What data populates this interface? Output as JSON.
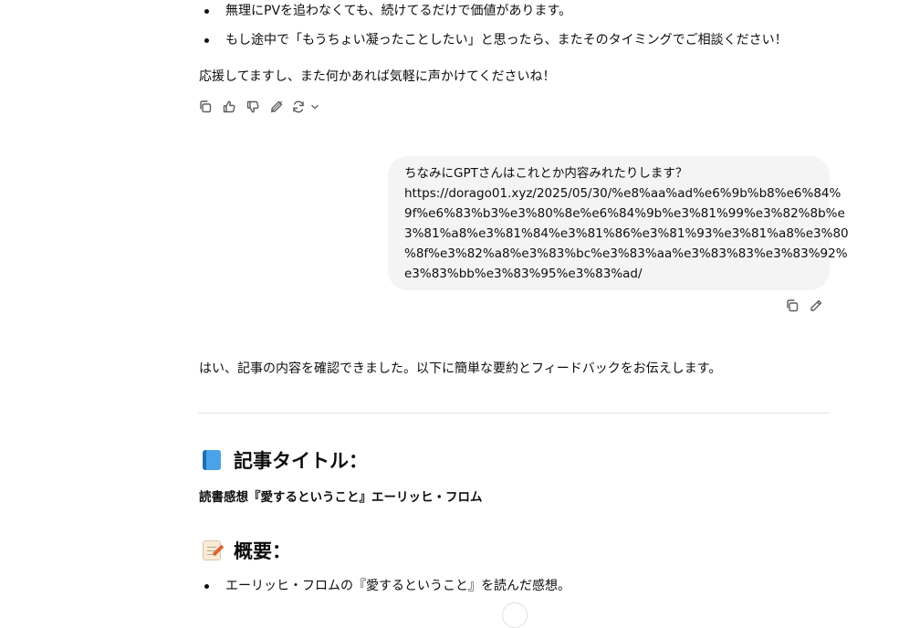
{
  "top_bullets": [
    "無理にPVを追わなくても、続けてるだけで価値があります。",
    "もし途中で「もうちょい凝ったことしたい」と思ったら、またそのタイミングでご相談ください！"
  ],
  "assistant_closing": "応援してますし、また何かあれば気軽に声かけてくださいね！",
  "assistant_actions": {
    "copy": "copy-icon",
    "like": "thumbs-up-icon",
    "dislike": "thumbs-down-icon",
    "edit_canvas": "edit-canvas-icon",
    "regenerate": "regenerate-icon"
  },
  "user_message": {
    "lines": [
      "ちなみにGPTさんはこれとか内容みれたりします？",
      "https://dorago01.xyz/2025/05/30/%e8%aa%ad%e6%9b%b8%e6%84%",
      "9f%e6%83%b3%e3%80%8e%e6%84%9b%e3%81%99%e3%82%8b%e",
      "3%81%a8%e3%81%84%e3%81%86%e3%81%93%e3%81%a8%e3%80",
      "%8f%e3%82%a8%e3%83%bc%e3%83%aa%e3%83%83%e3%83%92%",
      "e3%83%bb%e3%83%95%e3%83%ad/"
    ]
  },
  "assistant_reply": {
    "intro": "はい、記事の内容を確認できました。以下に簡単な要約とフィードバックをお伝えします。",
    "section1_title": "記事タイトル：",
    "section1_body": "読書感想『愛するということ』エーリッヒ・フロム",
    "section2_title": "概要：",
    "section2_bullets": [
      "エーリッヒ・フロムの『愛するということ』を読んだ感想。"
    ]
  }
}
